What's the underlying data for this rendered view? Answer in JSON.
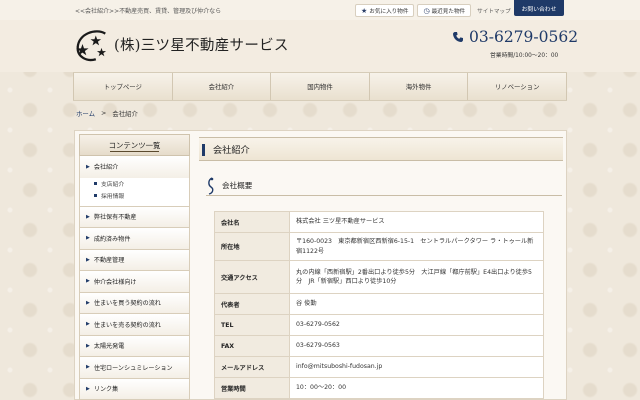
{
  "top": {
    "tagline": "<<会社紹介>>不動産売買、賃貸、管理及び仲介なら",
    "favorites_label": "お気に入り物件",
    "recent_label": "最近見た物件",
    "sitemap_label": "サイトマップ",
    "contact_label": "お問い合わせ"
  },
  "header": {
    "company_name": "(株)三ツ星不動産サービス",
    "phone": "03-6279-0562",
    "hours": "営業時間/10:00～20：00"
  },
  "nav": {
    "items": [
      "トップページ",
      "会社紹介",
      "国内物件",
      "海外物件",
      "リノベーション"
    ]
  },
  "breadcrumb": {
    "home": "ホーム",
    "separator": ">",
    "current": "会社紹介"
  },
  "sidebar": {
    "title": "コンテンツ一覧",
    "active_item": "会社紹介",
    "sub_items": [
      "支店紹介",
      "採用情報"
    ],
    "items": [
      "弊社保有不動産",
      "成約済み物件",
      "不動産管理",
      "仲介会社様向け",
      "住まいを買う契約の流れ",
      "住まいを売る契約の流れ",
      "太陽光発電",
      "住宅ローンシュミレーション",
      "リンク集"
    ]
  },
  "main": {
    "title": "会社紹介",
    "section_title": "会社概要",
    "rows": [
      {
        "key": "会社名",
        "value": "株式会社 三ツ星不動産サービス"
      },
      {
        "key": "所在地",
        "value": "〒160-0023　東京都新宿区西新宿6-15-1　セントラルパークタワー ラ・トゥール新宿1122号"
      },
      {
        "key": "交通アクセス",
        "value": "丸の内線「西新宿駅」2番出口より徒歩5分　大江戸線「都庁前駅」E4出口より徒歩5分　JR「新宿駅」西口より徒歩10分"
      },
      {
        "key": "代表者",
        "value": "谷 俊勤"
      },
      {
        "key": "TEL",
        "value": "03-6279-0562"
      },
      {
        "key": "FAX",
        "value": "03-6279-0563"
      },
      {
        "key": "メールアドレス",
        "value": "info@mitsuboshi-fudosan.jp"
      },
      {
        "key": "営業時間",
        "value": "10：00～20：00"
      }
    ]
  },
  "colors": {
    "brand_navy": "#1f3a68",
    "background": "#efe8dc",
    "table_key_bg": "#f1ebe0"
  }
}
